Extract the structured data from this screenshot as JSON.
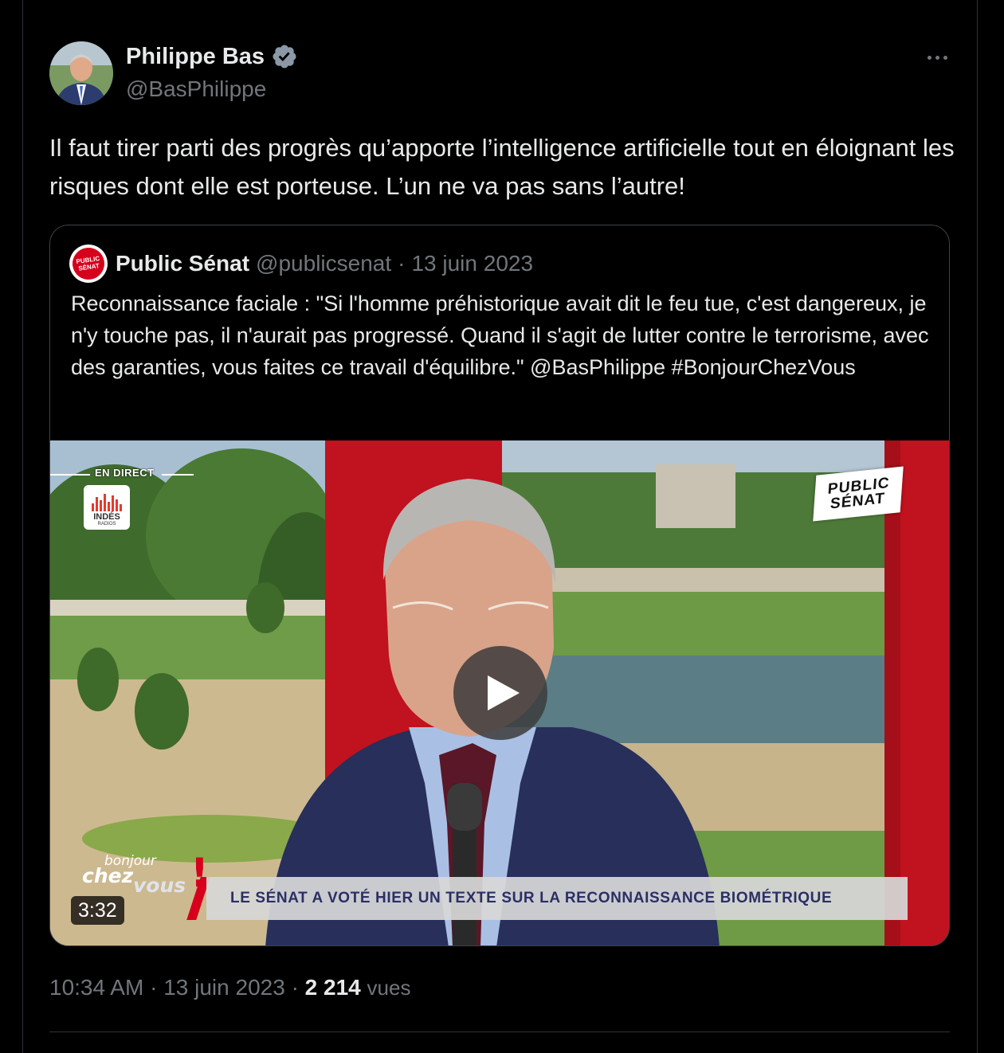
{
  "tweet": {
    "author_name": "Philippe Bas",
    "author_handle": "@BasPhilippe",
    "text": "Il faut tirer parti des progrès qu’apporte l’intelligence artificielle tout en éloignant les risques dont elle est porteuse. L’un ne va pas sans l’autre!",
    "time": "10:34 AM",
    "date": "13 juin 2023",
    "separator": "·",
    "views_count": "2 214",
    "views_label": "vues"
  },
  "quote": {
    "avatar_text_top": "PUBLIC",
    "avatar_text_bottom": "SÉNAT",
    "name": "Public Sénat",
    "handle": "@publicsenat",
    "separator": "·",
    "date": "13 juin 2023",
    "text": "Reconnaissance faciale : \"Si l'homme préhistorique avait dit le feu tue, c'est dangereux, je n'y touche pas, il n'aurait pas progressé. Quand il s'agit de lutter contre le terrorisme, avec des garanties, vous faites ce travail d'équilibre.\" @BasPhilippe #BonjourChezVous"
  },
  "video": {
    "live_label": "EN DIRECT",
    "indes_label": "INDÉS",
    "indes_sub": "RADIOS",
    "channel_logo_top": "PUBLIC",
    "channel_logo_bottom": "SÉNAT",
    "show_bonjour": "bonjour",
    "show_chez": "chez",
    "show_vous": "vous",
    "show_bang": "!",
    "lower_third": "LE SÉNAT A VOTÉ HIER UN TEXTE SUR LA RECONNAISSANCE BIOMÉTRIQUE",
    "duration": "3:32"
  },
  "icons": {
    "verified": "verified-badge-icon",
    "more": "more-options-icon",
    "play": "play-icon"
  },
  "colors": {
    "background": "#000000",
    "text_primary": "#e7e9ea",
    "text_secondary": "#71767b",
    "verified_badge": "#8b98a5",
    "brand_red": "#d6001c"
  }
}
